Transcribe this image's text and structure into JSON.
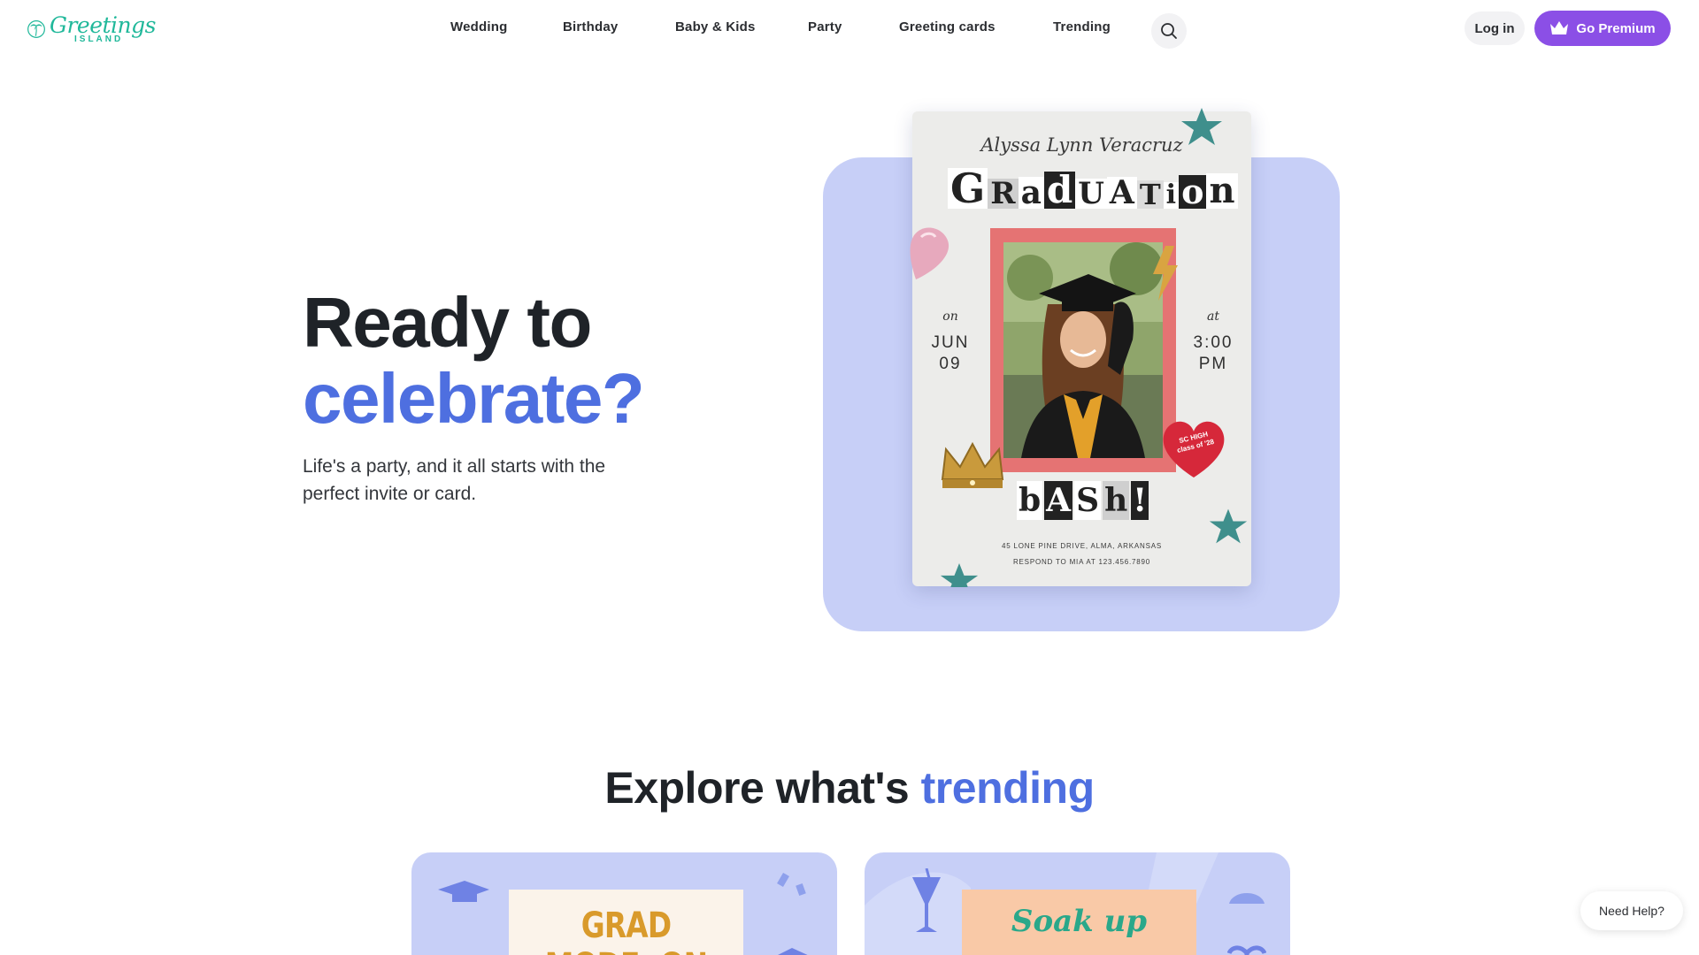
{
  "brand": {
    "name_script": "Greetings",
    "name_sub": "ISLAND",
    "logo_icon": "palm-tree-icon",
    "color": "#20b89a"
  },
  "nav": {
    "items": [
      {
        "label": "Wedding"
      },
      {
        "label": "Birthday"
      },
      {
        "label": "Baby & Kids"
      },
      {
        "label": "Party"
      },
      {
        "label": "Greeting cards"
      },
      {
        "label": "Trending"
      }
    ],
    "search_icon": "search-icon"
  },
  "account": {
    "login_label": "Log in",
    "premium_label": "Go Premium",
    "premium_icon": "crown-icon",
    "premium_color": "#8b4fe6"
  },
  "hero": {
    "title_line1": "Ready to",
    "title_line2": "celebrate?",
    "subtitle": "Life's a party, and it all starts with the perfect invite or card.",
    "accent_color": "#4e6fe0",
    "panel_color": "#c7cff7"
  },
  "invite": {
    "name": "Alyssa Lynn Veracruz",
    "title_letters": [
      "G",
      "R",
      "a",
      "d",
      "U",
      "A",
      "T",
      "i",
      "o",
      "n"
    ],
    "left_small": "on",
    "left_big_1": "JUN",
    "left_big_2": "09",
    "right_small": "at",
    "right_big_1": "3:00",
    "right_big_2": "PM",
    "bash_letters": [
      "b",
      "A",
      "S",
      "h",
      "!"
    ],
    "heart_text": "SC HIGH class of '28",
    "address_line1": "45 LONE PINE DRIVE, ALMA, ARKANSAS",
    "address_line2": "RESPOND TO MIA AT 123.456.7890"
  },
  "trending": {
    "title_plain": "Explore what's",
    "title_accent": "trending",
    "cards": [
      {
        "text": "GRAD MODE: ON"
      },
      {
        "text": "Soak up"
      }
    ]
  },
  "help": {
    "label": "Need Help?"
  }
}
